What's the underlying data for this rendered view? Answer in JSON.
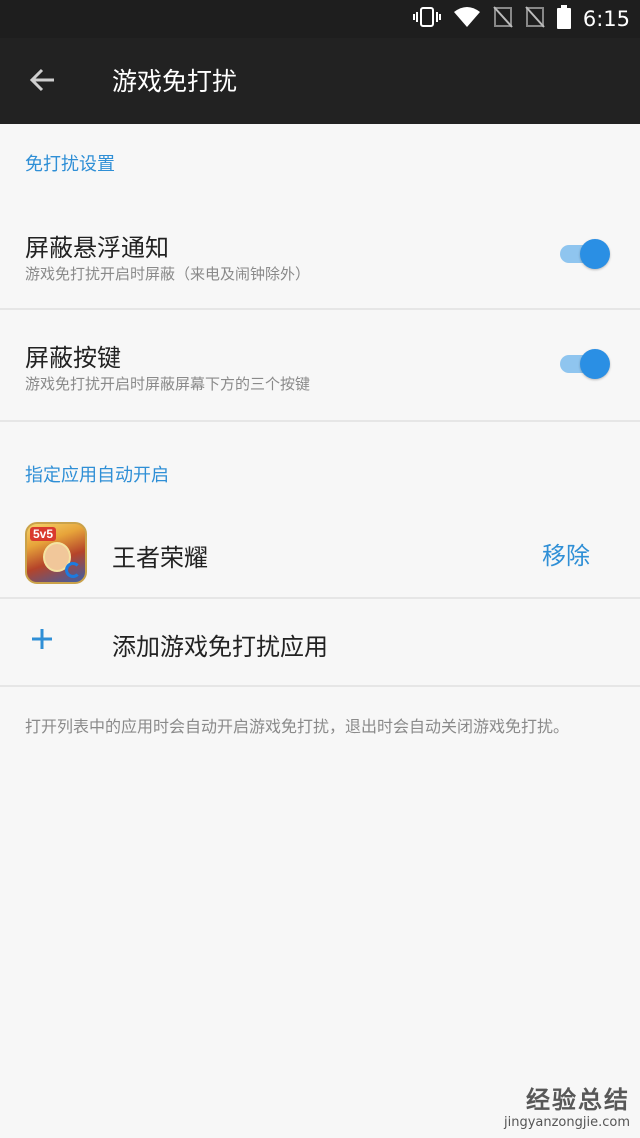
{
  "status_bar": {
    "time": "6:15",
    "icons": [
      "vibrate-icon",
      "wifi-icon",
      "no-sim-icon",
      "no-sim-icon",
      "battery-icon"
    ]
  },
  "app_bar": {
    "title": "游戏免打扰",
    "back_icon": "arrow-left-icon"
  },
  "section_settings": {
    "header": "免打扰设置",
    "items": [
      {
        "title": "屏蔽悬浮通知",
        "subtitle": "游戏免打扰开启时屏蔽（来电及闹钟除外）",
        "enabled": true
      },
      {
        "title": "屏蔽按键",
        "subtitle": "游戏免打扰开启时屏蔽屏幕下方的三个按键",
        "enabled": true
      }
    ]
  },
  "section_apps": {
    "header": "指定应用自动开启",
    "apps": [
      {
        "name": "王者荣耀",
        "icon_badge": "5v5",
        "remove_label": "移除"
      }
    ],
    "add_label": "添加游戏免打扰应用",
    "add_icon": "plus-icon",
    "footnote": "打开列表中的应用时会自动开启游戏免打扰，退出时会自动关闭游戏免打扰。"
  },
  "watermark": {
    "main": "经验总结",
    "url": "jingyanzongjie.com"
  },
  "colors": {
    "accent": "#2f8fd6",
    "toggle_thumb": "#2a8fe4",
    "toggle_track": "#8fc5ef",
    "app_bar": "#222222",
    "background": "#f7f7f7"
  }
}
